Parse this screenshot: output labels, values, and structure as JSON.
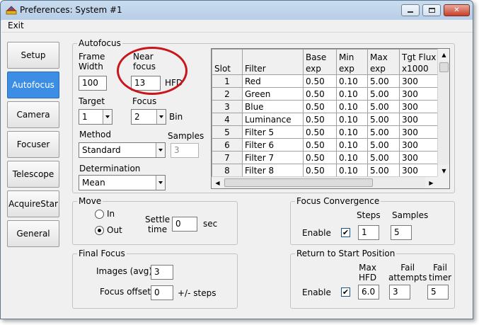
{
  "window": {
    "title": "Preferences: System #1"
  },
  "menu": {
    "exit": "Exit"
  },
  "nav": {
    "items": [
      {
        "label": "Setup",
        "active": false
      },
      {
        "label": "Autofocus",
        "active": true
      },
      {
        "label": "Camera",
        "active": false
      },
      {
        "label": "Focuser",
        "active": false
      },
      {
        "label": "Telescope",
        "active": false
      },
      {
        "label": "AcquireStar",
        "active": false
      },
      {
        "label": "General",
        "active": false
      }
    ]
  },
  "autofocus": {
    "group_label": "Autofocus",
    "frame_width_label": "Frame\nWidth",
    "frame_width_value": "100",
    "near_focus_label": "Near\nfocus",
    "near_focus_value": "13",
    "near_focus_unit": "HFD",
    "target_label": "Target",
    "target_value": "1",
    "focus_label": "Focus",
    "focus_value": "2",
    "bin_label": "Bin",
    "method_label": "Method",
    "method_value": "Standard",
    "samples_label": "Samples",
    "samples_value": "3",
    "determination_label": "Determination",
    "determination_value": "Mean"
  },
  "filter_table": {
    "columns": [
      "Slot",
      "Filter",
      "Base\nexp",
      "Min\nexp",
      "Max\nexp",
      "Tgt Flux\nx1000"
    ],
    "rows": [
      [
        "1",
        "Red",
        "0.50",
        "0.10",
        "5.00",
        "300"
      ],
      [
        "2",
        "Green",
        "0.50",
        "0.10",
        "5.00",
        "300"
      ],
      [
        "3",
        "Blue",
        "0.50",
        "0.10",
        "5.00",
        "300"
      ],
      [
        "4",
        "Luminance",
        "0.50",
        "0.10",
        "5.00",
        "300"
      ],
      [
        "5",
        "Filter 5",
        "0.50",
        "0.10",
        "5.00",
        "300"
      ],
      [
        "6",
        "Filter 6",
        "0.50",
        "0.10",
        "5.00",
        "300"
      ],
      [
        "7",
        "Filter 7",
        "0.50",
        "0.10",
        "5.00",
        "300"
      ],
      [
        "8",
        "Filter 8",
        "0.50",
        "0.10",
        "5.00",
        "300"
      ]
    ]
  },
  "move": {
    "group_label": "Move",
    "in_label": "In",
    "out_label": "Out",
    "selected": "Out",
    "settle_label": "Settle\ntime",
    "settle_value": "0",
    "settle_unit": "sec"
  },
  "final_focus": {
    "group_label": "Final Focus",
    "images_label": "Images (avg)",
    "images_value": "3",
    "offset_label": "Focus offset",
    "offset_value": "0",
    "offset_unit": "+/- steps"
  },
  "focus_convergence": {
    "group_label": "Focus Convergence",
    "steps_label": "Steps",
    "samples_label": "Samples",
    "enable_label": "Enable",
    "enable_checked": true,
    "steps_value": "1",
    "samples_value": "5"
  },
  "return_start": {
    "group_label": "Return to Start Position",
    "max_hfd_label": "Max\nHFD",
    "fail_attempts_label": "Fail\nattempts",
    "fail_timer_label": "Fail\ntimer",
    "enable_label": "Enable",
    "enable_checked": true,
    "max_hfd_value": "6.0",
    "fail_attempts_value": "3",
    "fail_timer_value": "5"
  },
  "icons": {
    "app": "app-logo-icon",
    "check": "✔"
  }
}
